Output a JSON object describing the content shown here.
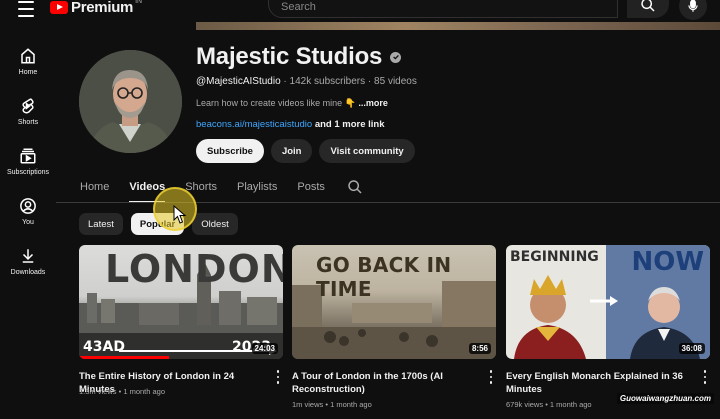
{
  "header": {
    "logo_text": "Premium",
    "logo_sup": "IN",
    "search_placeholder": "Search"
  },
  "icons": [
    "menu-icon",
    "youtube-logo",
    "search-icon",
    "mic-icon",
    "home-icon",
    "shorts-icon",
    "subscriptions-icon",
    "you-icon",
    "downloads-icon",
    "verified-icon",
    "kebab-icon"
  ],
  "sidebar": {
    "items": [
      {
        "label": "Home"
      },
      {
        "label": "Shorts"
      },
      {
        "label": "Subscriptions"
      },
      {
        "label": "You"
      },
      {
        "label": "Downloads"
      }
    ]
  },
  "channel": {
    "name": "Majestic Studios",
    "handle": "@MajesticAIStudio",
    "subscribers": "142k subscribers",
    "videos_count": "85 videos",
    "separator": "·",
    "description": "Learn how to create videos like mine 👇",
    "description_more": "...more",
    "link": "beacons.ai/majesticaistudio",
    "link_more": "and 1 more link",
    "buttons": {
      "subscribe": "Subscribe",
      "join": "Join",
      "community": "Visit community"
    }
  },
  "tabs": [
    {
      "label": "Home",
      "active": false
    },
    {
      "label": "Videos",
      "active": true
    },
    {
      "label": "Shorts",
      "active": false
    },
    {
      "label": "Playlists",
      "active": false
    },
    {
      "label": "Posts",
      "active": false
    }
  ],
  "chips": [
    {
      "label": "Latest",
      "active": false
    },
    {
      "label": "Popular",
      "active": true
    },
    {
      "label": "Oldest",
      "active": false
    }
  ],
  "videos": [
    {
      "title": "The Entire History of London in 24 Minutes",
      "views": "1.3m views",
      "age": "1 month ago",
      "duration": "24:03",
      "thumb_text": "LONDON",
      "thumb_left": "43AD",
      "thumb_right": "2023",
      "watch_progress": 0.44
    },
    {
      "title": "A Tour of London in the 1700s (AI Reconstruction)",
      "views": "1m views",
      "age": "1 month ago",
      "duration": "8:56",
      "thumb_text": "GO BACK IN TIME"
    },
    {
      "title": "Every English Monarch Explained in 36 Minutes",
      "views": "679k views",
      "age": "1 month ago",
      "duration": "36:08",
      "thumb_left": "BEGINNING",
      "thumb_right": "NOW"
    }
  ],
  "watermark": "Guowaiwangzhuan.com",
  "colors": {
    "background": "#0f0f0f",
    "brand_red": "#ff0000",
    "link_blue": "#3ea6ff",
    "cursor_highlight": "#e6c828"
  }
}
